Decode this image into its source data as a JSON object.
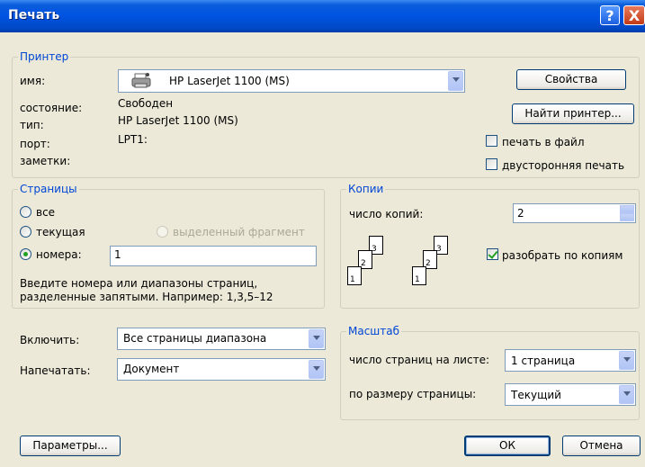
{
  "window": {
    "title": "Печать"
  },
  "printer": {
    "legend": "Принтер",
    "name_label": "имя:",
    "name_value": "HP LaserJet 1100 (MS)",
    "status_label": "состояние:",
    "status_value": "Свободен",
    "type_label": "тип:",
    "type_value": "HP LaserJet 1100 (MS)",
    "port_label": "порт:",
    "port_value": "LPT1:",
    "notes_label": "заметки:",
    "properties_button": "Свойства",
    "find_button": "Найти принтер...",
    "print_to_file": "печать в файл",
    "duplex": "двусторонняя печать",
    "print_to_file_checked": false,
    "duplex_checked": false
  },
  "pages": {
    "legend": "Страницы",
    "all": "все",
    "current": "текущая",
    "selection": "выделенный фрагмент",
    "numbers": "номера:",
    "numbers_value": "1",
    "hint_line1": "Введите номера или диапазоны страниц,",
    "hint_line2": "разделенные запятыми. Например: 1,3,5–12",
    "selected": "numbers"
  },
  "copies": {
    "legend": "Копии",
    "count_label": "число копий:",
    "count_value": "2",
    "collate": "разобрать по копиям",
    "collate_checked": true,
    "page_numbers": [
      "1",
      "2",
      "3"
    ]
  },
  "include": {
    "label": "Включить:",
    "value": "Все страницы диапазона"
  },
  "print_what": {
    "label": "Напечатать:",
    "value": "Документ"
  },
  "zoom": {
    "legend": "Масштаб",
    "pages_per_sheet_label": "число страниц на листе:",
    "pages_per_sheet_value": "1 страница",
    "scale_label": "по размеру страницы:",
    "scale_value": "Текущий"
  },
  "buttons": {
    "options": "Параметры...",
    "ok": "ОК",
    "cancel": "Отмена"
  },
  "icons": {
    "help": "?",
    "close": "X",
    "printer": "printer-icon"
  }
}
